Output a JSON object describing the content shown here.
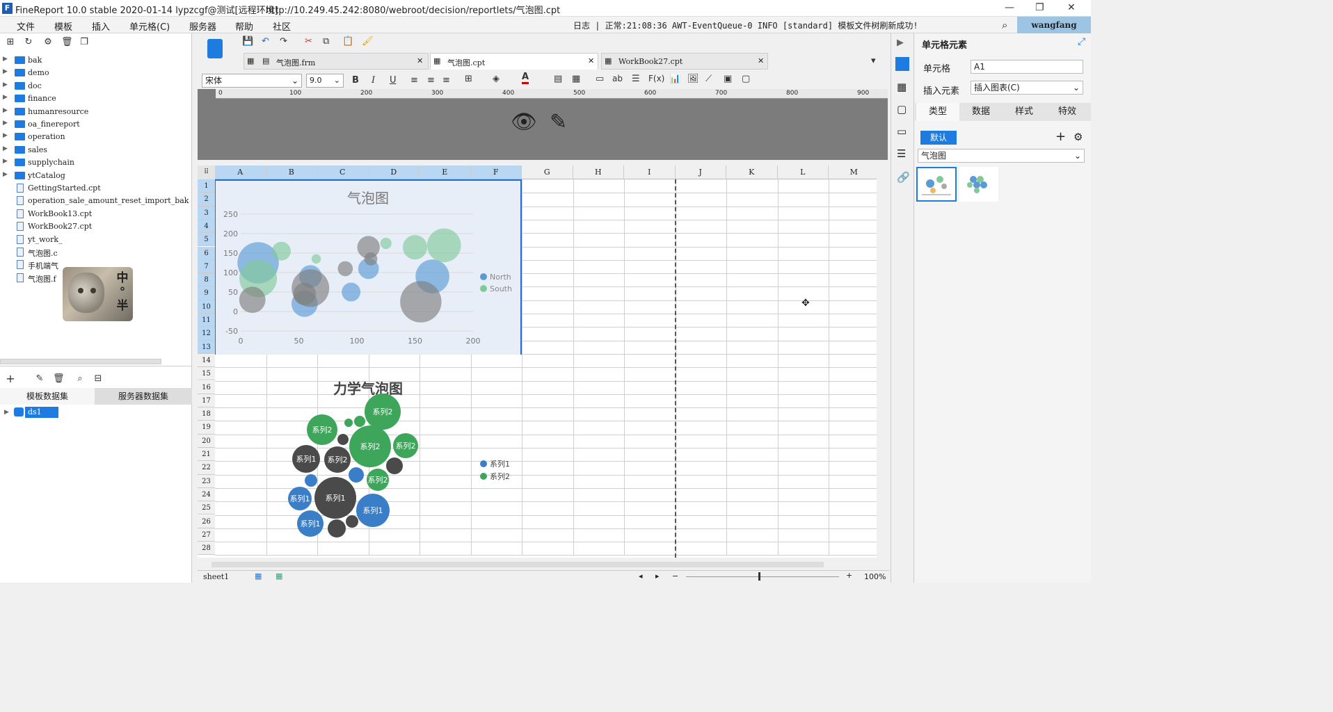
{
  "window": {
    "title": "FineReport 10.0 stable 2020-01-14 lypzcgf@测试[远程环境]",
    "url": "http://10.249.45.242:8080/webroot/decision/reportlets/气泡图.cpt",
    "user": "wangfang"
  },
  "menu": [
    "文件",
    "模板",
    "插入",
    "单元格(C)",
    "服务器",
    "帮助",
    "社区"
  ],
  "status": "日志 | 正常:21:08:36 AWT-EventQueue-0 INFO [standard] 模板文件树刷新成功!",
  "tree": [
    {
      "label": "bak",
      "type": "folder"
    },
    {
      "label": "demo",
      "type": "folder"
    },
    {
      "label": "doc",
      "type": "folder"
    },
    {
      "label": "finance",
      "type": "folder"
    },
    {
      "label": "humanresource",
      "type": "folder"
    },
    {
      "label": "oa_finereport",
      "type": "folder"
    },
    {
      "label": "operation",
      "type": "folder"
    },
    {
      "label": "sales",
      "type": "folder"
    },
    {
      "label": "supplychain",
      "type": "folder"
    },
    {
      "label": "ytCatalog",
      "type": "folder"
    },
    {
      "label": "GettingStarted.cpt",
      "type": "file"
    },
    {
      "label": "operation_sale_amount_reset_import_bak",
      "type": "file"
    },
    {
      "label": "WorkBook13.cpt",
      "type": "file"
    },
    {
      "label": "WorkBook27.cpt",
      "type": "file"
    },
    {
      "label": "yt_work_",
      "type": "file"
    },
    {
      "label": "气泡图.c",
      "type": "file"
    },
    {
      "label": "手机端气",
      "type": "file"
    },
    {
      "label": "气泡图.f",
      "type": "file"
    }
  ],
  "overlay": {
    "chars": [
      "中",
      "°",
      "半"
    ]
  },
  "dataset_tabs": [
    "模板数据集",
    "服务器数据集"
  ],
  "dataset": "ds1",
  "doc_tabs": [
    {
      "label": "气泡图.frm"
    },
    {
      "label": "气泡图.cpt"
    },
    {
      "label": "WorkBook27.cpt"
    }
  ],
  "format": {
    "font": "宋体",
    "size": "9.0"
  },
  "ruler_ticks": [
    "0",
    "100",
    "200",
    "300",
    "400",
    "500",
    "600",
    "700",
    "800",
    "900",
    "100"
  ],
  "columns": [
    "A",
    "B",
    "C",
    "D",
    "E",
    "F",
    "G",
    "H",
    "I",
    "J",
    "K",
    "L",
    "M"
  ],
  "rows": [
    "1",
    "2",
    "3",
    "4",
    "5",
    "6",
    "7",
    "8",
    "9",
    "10",
    "11",
    "12",
    "13",
    "14",
    "15",
    "16",
    "17",
    "18",
    "19",
    "20",
    "21",
    "22",
    "23",
    "24",
    "25",
    "26",
    "27",
    "28"
  ],
  "right_panel": {
    "title": "单元格元素",
    "cell_label": "单元格",
    "cell_value": "A1",
    "insert_label": "插入元素",
    "insert_value": "插入图表(C)",
    "tabs": [
      "类型",
      "数据",
      "样式",
      "特效"
    ],
    "default_btn": "默认",
    "chart_type": "气泡图"
  },
  "sheet_tab": "sheet1",
  "zoom": "100%",
  "chart_data": [
    {
      "type": "scatter",
      "title": "气泡图",
      "xlim": [
        0,
        200
      ],
      "ylim": [
        -50,
        250
      ],
      "x_ticks": [
        "0",
        "50",
        "100",
        "150",
        "200"
      ],
      "y_ticks": [
        "250",
        "200",
        "150",
        "100",
        "50",
        "0",
        "-50"
      ],
      "series": [
        {
          "name": "North",
          "color": "#5b9bd5",
          "points": [
            [
              15,
              125,
              22
            ],
            [
              60,
              90,
              12
            ],
            [
              110,
              110,
              11
            ],
            [
              165,
              90,
              18
            ],
            [
              55,
              20,
              14
            ],
            [
              95,
              50,
              10
            ]
          ]
        },
        {
          "name": "South",
          "color": "#82c99a",
          "points": [
            [
              35,
              155,
              10
            ],
            [
              65,
              135,
              5
            ],
            [
              15,
              85,
              20
            ],
            [
              150,
              165,
              13
            ],
            [
              175,
              170,
              18
            ],
            [
              125,
              175,
              6
            ]
          ]
        },
        {
          "name": "",
          "color": "#808080",
          "points": [
            [
              10,
              30,
              14
            ],
            [
              60,
              60,
              20
            ],
            [
              110,
              165,
              12
            ],
            [
              112,
              135,
              7
            ],
            [
              155,
              25,
              22
            ],
            [
              90,
              110,
              8
            ],
            [
              55,
              45,
              12
            ]
          ]
        }
      ],
      "legend": [
        "North",
        "South"
      ],
      "legend_position": "right"
    },
    {
      "type": "bubble-force",
      "title": "力学气泡图",
      "legend": [
        "系列1",
        "系列2"
      ],
      "legend_position": "right",
      "bubble_labels": [
        "系列2",
        "系列2",
        "系列2",
        "系列2",
        "系列1",
        "系列2",
        "系列2",
        "系列1",
        "系列1",
        "系列1",
        "系列1"
      ]
    }
  ]
}
